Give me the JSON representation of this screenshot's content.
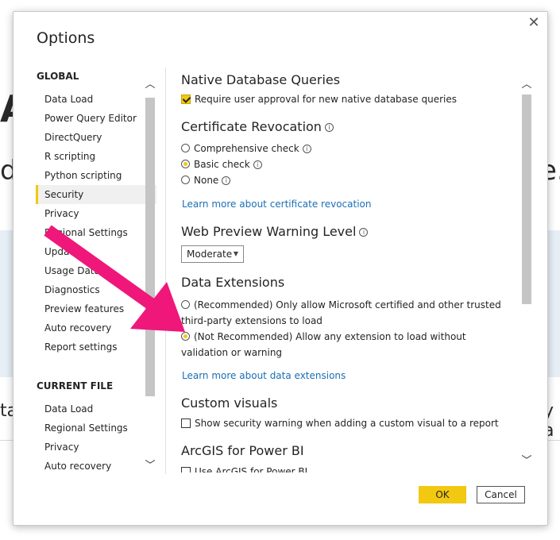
{
  "background": {
    "letters": {
      "a": "A",
      "d": "d,",
      "e": "e.",
      "ta": "ta",
      "ya": "y a"
    }
  },
  "dialog": {
    "title": "Options",
    "close_glyph": "✕"
  },
  "nav": {
    "global_label": "GLOBAL",
    "global_items": [
      "Data Load",
      "Power Query Editor",
      "DirectQuery",
      "R scripting",
      "Python scripting",
      "Security",
      "Privacy",
      "Regional Settings",
      "Updates",
      "Usage Data",
      "Diagnostics",
      "Preview features",
      "Auto recovery",
      "Report settings"
    ],
    "active_item": "Security",
    "current_file_label": "CURRENT FILE",
    "current_file_items": [
      "Data Load",
      "Regional Settings",
      "Privacy",
      "Auto recovery"
    ]
  },
  "content": {
    "native_db": {
      "title": "Native Database Queries",
      "checkbox_label": "Require user approval for new native database queries",
      "checked": true
    },
    "cert_revocation": {
      "title": "Certificate Revocation",
      "options": [
        "Comprehensive check",
        "Basic check",
        "None"
      ],
      "selected": "Basic check",
      "link": "Learn more about certificate revocation"
    },
    "web_preview": {
      "title": "Web Preview Warning Level",
      "selected_value": "Moderate"
    },
    "data_extensions": {
      "title": "Data Extensions",
      "option1": "(Recommended) Only allow Microsoft certified and other trusted third-party extensions to load",
      "option2": "(Not Recommended) Allow any extension to load without validation or warning",
      "selected": "option2",
      "link": "Learn more about data extensions"
    },
    "custom_visuals": {
      "title": "Custom visuals",
      "checkbox_label": "Show security warning when adding a custom visual to a report",
      "checked": false
    },
    "arcgis": {
      "title": "ArcGIS for Power BI",
      "checkbox_label": "Use ArcGIS for Power BI"
    }
  },
  "footer": {
    "ok_label": "OK",
    "cancel_label": "Cancel"
  },
  "colors": {
    "accent": "#f2c811",
    "link": "#1a6fb5",
    "arrow": "#f0177a"
  }
}
